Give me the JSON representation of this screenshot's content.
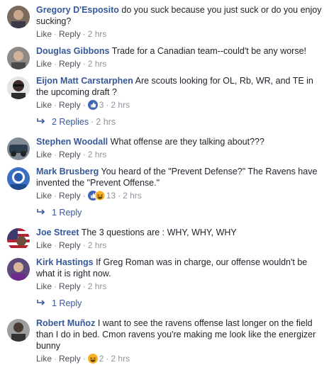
{
  "actions": {
    "like_label": "Like",
    "reply_label": "Reply",
    "separator": "·"
  },
  "colors": {
    "author_link": "#365899",
    "meta_text": "#90949c",
    "body_text": "#1d2129",
    "like_reaction": "#4267b2",
    "haha_reaction": "#f7b125"
  },
  "comments": [
    {
      "author": "Gregory D'Esposito",
      "text": "do you suck because you just suck or do you enjoy sucking?",
      "time": "2 hrs",
      "avatar_icon": "profile-photo"
    },
    {
      "author": "Douglas Gibbons",
      "text": "Trade for a Canadian team--could't be any worse!",
      "time": "2 hrs",
      "avatar_icon": "profile-photo"
    },
    {
      "author": "Eijon Matt Carstarphen",
      "text": "Are scouts looking for OL, Rb, WR, and TE in the upcoming draft ?",
      "time": "2 hrs",
      "reactions": {
        "count": "3",
        "icons": [
          "like-reaction-icon"
        ]
      },
      "replies": {
        "label": "2 Replies",
        "time": "2 hrs"
      },
      "avatar_icon": "profile-photo"
    },
    {
      "author": "Stephen Woodall",
      "text": "What offense are they talking about???",
      "time": "2 hrs",
      "avatar_icon": "profile-photo"
    },
    {
      "author": "Mark Brusberg",
      "text": "You heard of the \"Prevent Defense?\" The Ravens have invented the \"Prevent Offense.\"",
      "time": "2 hrs",
      "reactions": {
        "count": "13",
        "icons": [
          "like-reaction-icon",
          "haha-reaction-icon"
        ]
      },
      "replies": {
        "label": "1 Reply",
        "time": ""
      },
      "avatar_icon": "profile-photo"
    },
    {
      "author": "Joe Street",
      "text": "The 3 questions are : WHY, WHY, WHY",
      "time": "2 hrs",
      "avatar_icon": "profile-photo"
    },
    {
      "author": "Kirk Hastings",
      "text": "If Greg Roman was in charge, our offense wouldn't be what it is right now.",
      "time": "2 hrs",
      "replies": {
        "label": "1 Reply",
        "time": ""
      },
      "avatar_icon": "profile-photo"
    },
    {
      "author": "Robert Muñoz",
      "text": "I want to see the ravens offense last longer on the field than I do in bed. Cmon ravens you're making me look like the energizer bunny",
      "time": "2 hrs",
      "reactions": {
        "count": "2",
        "icons": [
          "haha-reaction-icon"
        ]
      },
      "avatar_icon": "profile-photo"
    }
  ]
}
